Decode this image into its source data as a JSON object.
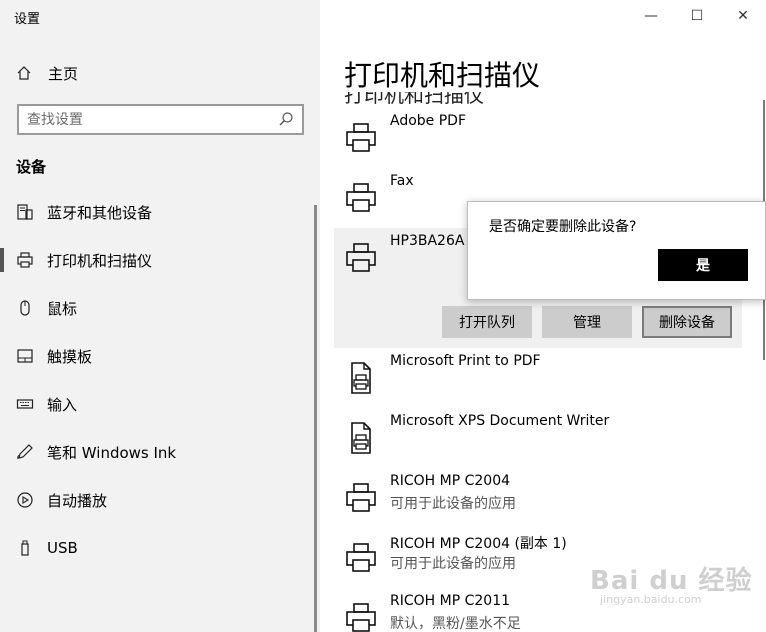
{
  "app_title": "设置",
  "sidebar": {
    "home_label": "主页",
    "search_placeholder": "查找设置",
    "section_label": "设备",
    "items": [
      {
        "label": "蓝牙和其他设备",
        "icon": "bluetooth-devices-icon"
      },
      {
        "label": "打印机和扫描仪",
        "icon": "printer-icon"
      },
      {
        "label": "鼠标",
        "icon": "mouse-icon"
      },
      {
        "label": "触摸板",
        "icon": "touchpad-icon"
      },
      {
        "label": "输入",
        "icon": "keyboard-icon"
      },
      {
        "label": "笔和 Windows Ink",
        "icon": "pen-icon"
      },
      {
        "label": "自动播放",
        "icon": "autoplay-icon"
      },
      {
        "label": "USB",
        "icon": "usb-icon"
      }
    ]
  },
  "window_controls": {
    "minimize": "—",
    "maximize": "☐",
    "close": "✕"
  },
  "main": {
    "title": "打印机和扫描仪",
    "subtitle": "打印机和扫描仪",
    "printers": [
      {
        "name": "Adobe PDF",
        "status": ""
      },
      {
        "name": "Fax",
        "status": ""
      },
      {
        "name": "HP3BA26A (",
        "status": ""
      },
      {
        "name": "Microsoft Print to PDF",
        "status": ""
      },
      {
        "name": "Microsoft XPS Document Writer",
        "status": ""
      },
      {
        "name": "RICOH MP C2004",
        "status": "可用于此设备的应用"
      },
      {
        "name": "RICOH MP C2004 (副本 1)",
        "status": "可用于此设备的应用"
      },
      {
        "name": "RICOH MP C2011",
        "status": "默认，黑粉/墨水不足"
      }
    ],
    "buttons": {
      "open_queue": "打开队列",
      "manage": "管理",
      "remove": "删除设备"
    }
  },
  "dialog": {
    "message": "是否确定要删除此设备?",
    "yes_label": "是"
  },
  "watermark": {
    "brand": "Bai du 经验",
    "url": "jingyan.baidu.com"
  },
  "colors": {
    "sidebar_bg": "#f2f2f2",
    "selected_bg": "#f0f0f0",
    "button_bg": "#cccccc",
    "primary_button": "#000000"
  }
}
